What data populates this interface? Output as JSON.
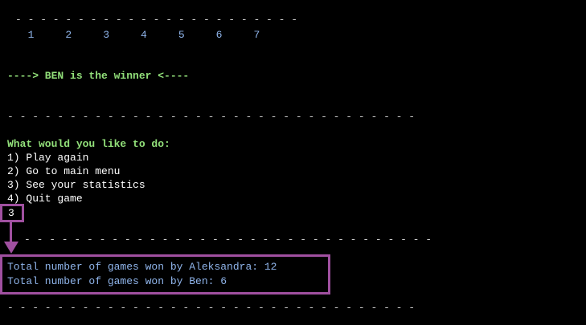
{
  "terminal": {
    "top_dashes": "- - - - - - - - - - - - - - - - - - - - - - -",
    "column_numbers": "  1     2     3     4     5     6     7",
    "winner_line": "----> BEN is the winner <----",
    "separator": "- - - - - - - - - - - - - - - - - - - - - - - - - - - - - - - - -",
    "menu": {
      "prompt": "What would you like to do:",
      "options": [
        "1) Play again",
        "2) Go to main menu",
        "3) See your statistics",
        "4) Quit game"
      ],
      "input_value": "3"
    },
    "stats": {
      "line1": "Total number of games won by Aleksandra: 12",
      "line2": "Total number of games won by Ben: 6"
    }
  },
  "colors": {
    "background": "#000000",
    "green_text": "#92e07a",
    "blue_text": "#8fb4ea",
    "highlight": "#a050a0"
  }
}
